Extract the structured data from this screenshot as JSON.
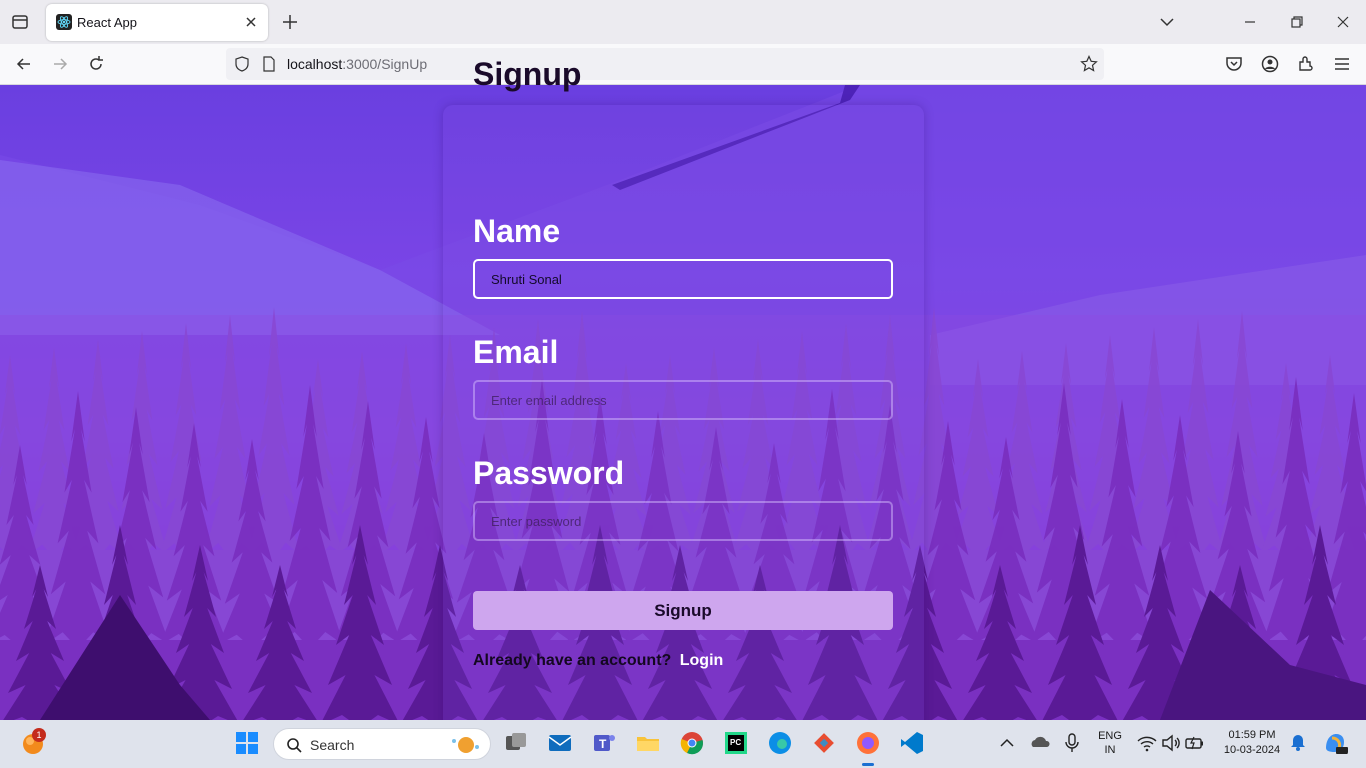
{
  "browser": {
    "tab_title": "React App",
    "url_host": "localhost",
    "url_rest": ":3000/SignUp"
  },
  "form": {
    "title": "Signup",
    "name_label": "Name",
    "name_value": "Shruti Sonal",
    "email_label": "Email",
    "email_placeholder": "Enter email address",
    "password_label": "Password",
    "password_placeholder": "Enter password",
    "submit_label": "Signup",
    "login_prompt": "Already have an account?",
    "login_link": "Login"
  },
  "taskbar": {
    "search_placeholder": "Search",
    "notification_count": "1",
    "language_line1": "ENG",
    "language_line2": "IN",
    "time": "01:59 PM",
    "date": "10-03-2024"
  },
  "colors": {
    "page_top": "#6a3fe0",
    "page_bottom": "#6a1f9e",
    "button_bg": "#cea6ee",
    "label_color": "#ffffff"
  },
  "icons": [
    "tab-list-icon",
    "react-favicon-icon",
    "close-icon",
    "plus-icon",
    "chevron-down-icon",
    "minimize-icon",
    "restore-icon",
    "back-arrow-icon",
    "forward-arrow-icon",
    "reload-icon",
    "shield-icon",
    "page-icon",
    "star-icon",
    "pocket-icon",
    "account-icon",
    "extensions-icon",
    "menu-icon",
    "windows-start-icon",
    "search-icon",
    "file-explorer-icon",
    "chrome-icon",
    "edge-icon",
    "firefox-icon",
    "vscode-icon",
    "wifi-icon",
    "volume-icon",
    "bell-icon"
  ]
}
